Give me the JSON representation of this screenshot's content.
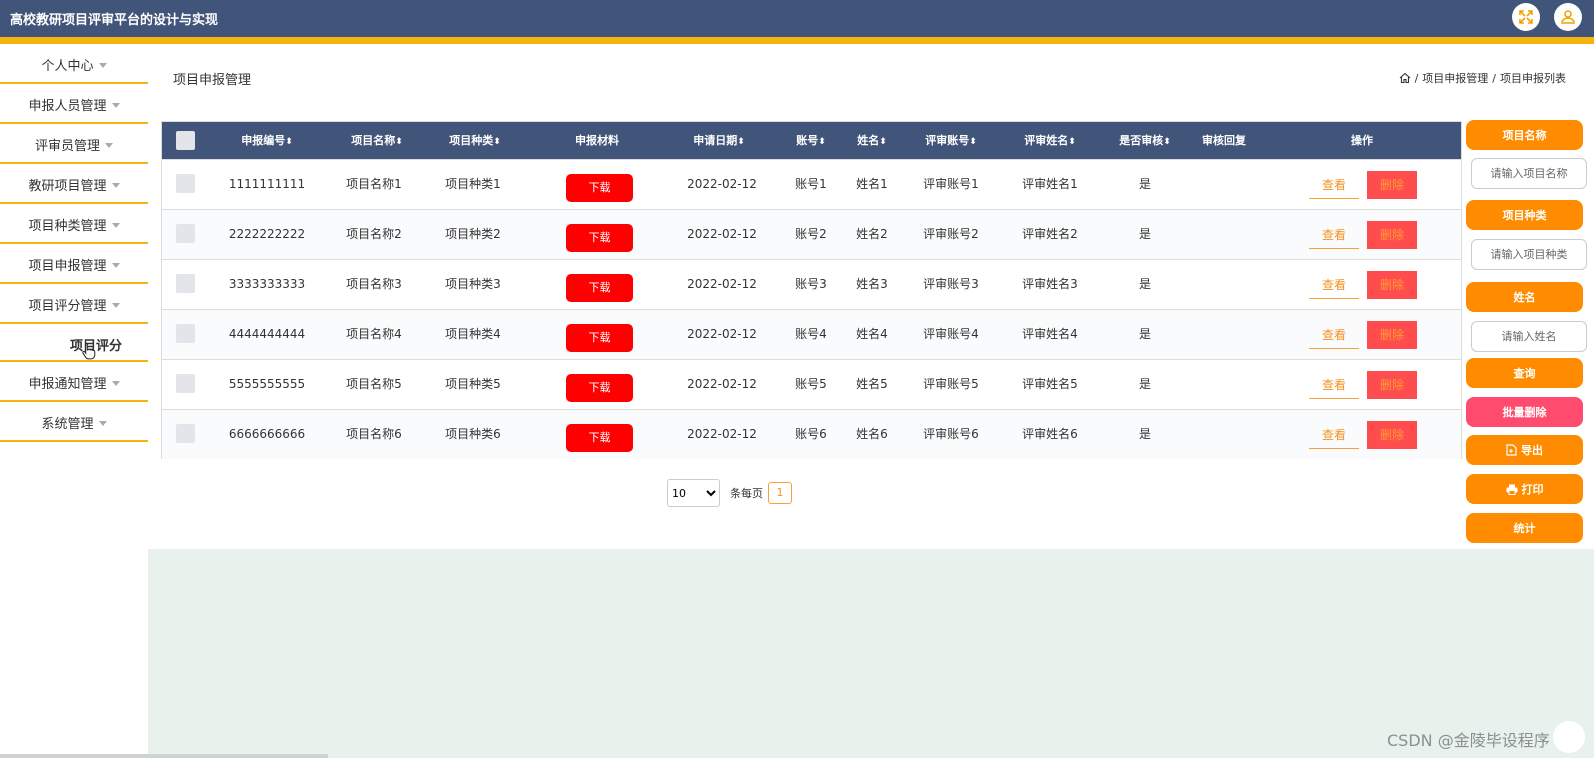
{
  "header": {
    "app_title": "高校教研项目评审平台的设计与实现",
    "icons": [
      "fullscreen-icon",
      "user-icon"
    ]
  },
  "colors": {
    "header": "#415479",
    "accent": "#f5b40c",
    "button": "#ff8c00",
    "download": "#ff0000",
    "danger": "#ff4d4f"
  },
  "sidebar": {
    "items": [
      {
        "label": "个人中心"
      },
      {
        "label": "申报人员管理"
      },
      {
        "label": "评审员管理"
      },
      {
        "label": "教研项目管理"
      },
      {
        "label": "项目种类管理"
      },
      {
        "label": "项目申报管理"
      },
      {
        "label": "项目评分管理"
      },
      {
        "label": "申报通知管理"
      },
      {
        "label": "系统管理"
      }
    ],
    "expanded_sub": "项目评分"
  },
  "main": {
    "page_title": "项目申报管理",
    "breadcrumb": [
      "项目申报管理",
      "项目申报列表"
    ],
    "table": {
      "headers": [
        "申报编号",
        "项目名称",
        "项目种类",
        "申报材料",
        "申请日期",
        "账号",
        "姓名",
        "评审账号",
        "评审姓名",
        "是否审核",
        "审核回复",
        "操作"
      ],
      "download_label": "下载",
      "view_label": "查看",
      "delete_label": "删除",
      "rows": [
        {
          "code": "1111111111",
          "name": "项目名称1",
          "kind": "项目种类1",
          "date": "2022-02-12",
          "account": "账号1",
          "person": "姓名1",
          "rev_account": "评审账号1",
          "rev_name": "评审姓名1",
          "audited": "是"
        },
        {
          "code": "2222222222",
          "name": "项目名称2",
          "kind": "项目种类2",
          "date": "2022-02-12",
          "account": "账号2",
          "person": "姓名2",
          "rev_account": "评审账号2",
          "rev_name": "评审姓名2",
          "audited": "是"
        },
        {
          "code": "3333333333",
          "name": "项目名称3",
          "kind": "项目种类3",
          "date": "2022-02-12",
          "account": "账号3",
          "person": "姓名3",
          "rev_account": "评审账号3",
          "rev_name": "评审姓名3",
          "audited": "是"
        },
        {
          "code": "4444444444",
          "name": "项目名称4",
          "kind": "项目种类4",
          "date": "2022-02-12",
          "account": "账号4",
          "person": "姓名4",
          "rev_account": "评审账号4",
          "rev_name": "评审姓名4",
          "audited": "是"
        },
        {
          "code": "5555555555",
          "name": "项目名称5",
          "kind": "项目种类5",
          "date": "2022-02-12",
          "account": "账号5",
          "person": "姓名5",
          "rev_account": "评审账号5",
          "rev_name": "评审姓名5",
          "audited": "是"
        },
        {
          "code": "6666666666",
          "name": "项目名称6",
          "kind": "项目种类6",
          "date": "2022-02-12",
          "account": "账号6",
          "person": "姓名6",
          "rev_account": "评审账号6",
          "rev_name": "评审姓名6",
          "audited": "是"
        }
      ]
    },
    "pager": {
      "page_size": "10",
      "per_page_label": "条每页",
      "current_page": "1"
    }
  },
  "search": {
    "name_label": "项目名称",
    "name_placeholder": "请输入项目名称",
    "kind_label": "项目种类",
    "kind_placeholder": "请输入项目种类",
    "person_label": "姓名",
    "person_placeholder": "请输入姓名",
    "query_label": "查询",
    "batch_delete_label": "批量删除",
    "export_label": "导出",
    "print_label": "打印",
    "stats_label": "统计"
  },
  "watermark": "CSDN @金陵毕设程序"
}
